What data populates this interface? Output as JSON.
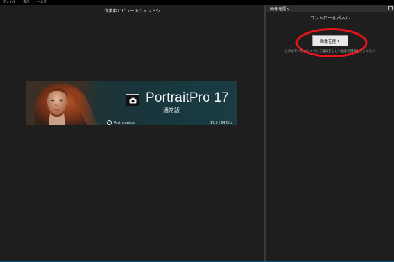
{
  "menu": {
    "items": [
      {
        "label": "ファイル"
      },
      {
        "label": "表示"
      },
      {
        "label": "ヘルプ"
      }
    ]
  },
  "work_view": {
    "title": "作業中とビューのウィンドウ"
  },
  "splash": {
    "brand": "PortraitPro 17",
    "edition": "通常版",
    "company": "Anthropics",
    "version": "17.5 | 64 Bits",
    "logo_icon": "camera-icon"
  },
  "control_panel": {
    "header_title": "画像を開く",
    "title": "コントロールパネル",
    "open_button_label": "画像を開く",
    "hint": "このボタンをクリックして編集をしたい画像を選択してください",
    "annotation_color": "#e3151b"
  },
  "colors": {
    "background": "#1e1e1e",
    "menubar": "#000000",
    "panel_header": "#2f2f2f",
    "splash_teal": "#17363d"
  }
}
